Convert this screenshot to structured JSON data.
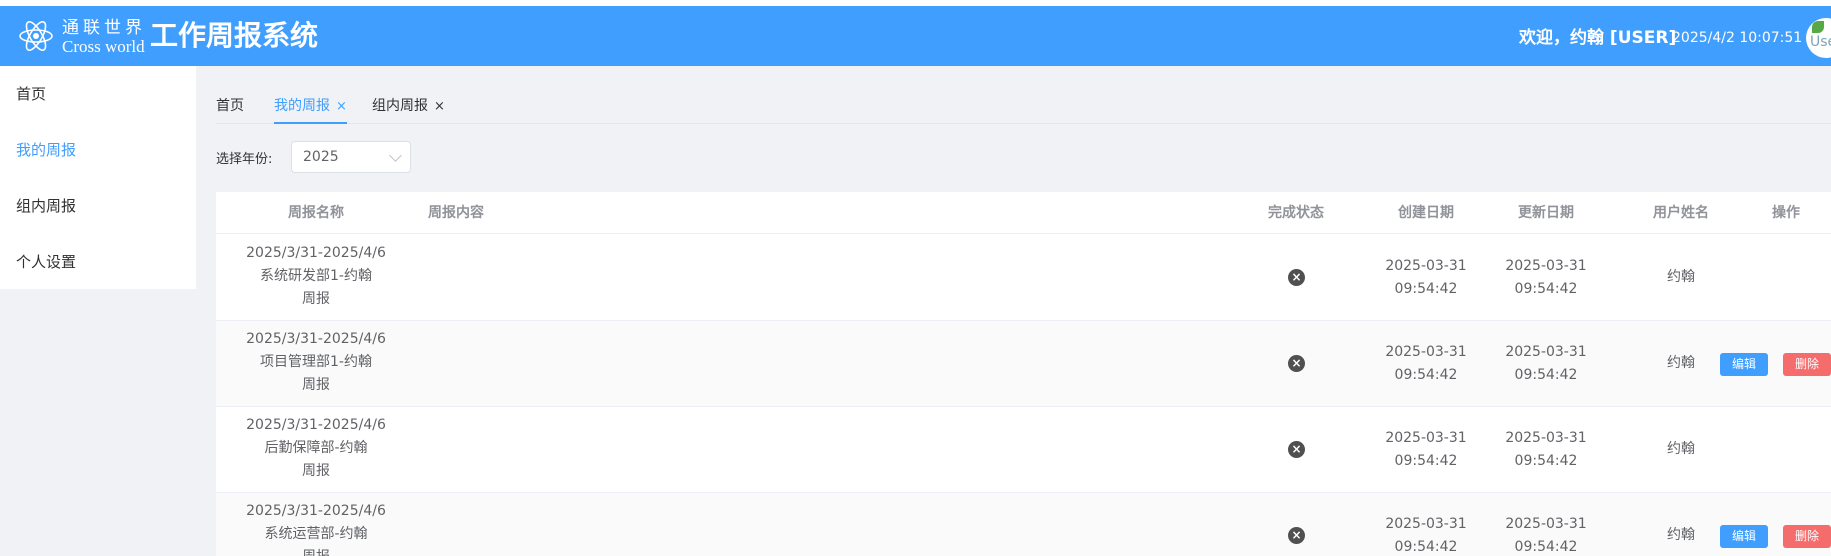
{
  "header": {
    "brand_cn": "通联世界",
    "brand_en": "Cross world",
    "app_title": "工作周报系统",
    "welcome": "欢迎，约翰 [USER]",
    "datetime": "2025/4/2 10:07:51",
    "avatar_text": "Use"
  },
  "sidebar": {
    "items": [
      {
        "label": "首页"
      },
      {
        "label": "我的周报"
      },
      {
        "label": "组内周报"
      },
      {
        "label": "个人设置"
      }
    ]
  },
  "tabs": [
    {
      "label": "首页"
    },
    {
      "label": "我的周报"
    },
    {
      "label": "组内周报"
    }
  ],
  "tab_close_glyph": "×",
  "filter": {
    "label": "选择年份:",
    "year": "2025"
  },
  "table": {
    "columns": [
      "周报名称",
      "周报内容",
      "完成状态",
      "创建日期",
      "更新日期",
      "用户姓名",
      "操作"
    ],
    "rows": [
      {
        "name_1": "2025/3/31-2025/4/6",
        "name_2": "系统研发部1-约翰",
        "name_3": "周报",
        "created_date": "2025-03-31",
        "created_time": "09:54:42",
        "updated_date": "2025-03-31",
        "updated_time": "09:54:42",
        "user": "约翰"
      },
      {
        "name_1": "2025/3/31-2025/4/6",
        "name_2": "项目管理部1-约翰",
        "name_3": "周报",
        "created_date": "2025-03-31",
        "created_time": "09:54:42",
        "updated_date": "2025-03-31",
        "updated_time": "09:54:42",
        "user": "约翰"
      },
      {
        "name_1": "2025/3/31-2025/4/6",
        "name_2": "后勤保障部-约翰",
        "name_3": "周报",
        "created_date": "2025-03-31",
        "created_time": "09:54:42",
        "updated_date": "2025-03-31",
        "updated_time": "09:54:42",
        "user": "约翰"
      },
      {
        "name_1": "2025/3/31-2025/4/6",
        "name_2": "系统运营部-约翰",
        "name_3": "周报",
        "created_date": "2025-03-31",
        "created_time": "09:54:42",
        "updated_date": "2025-03-31",
        "updated_time": "09:54:42",
        "user": "约翰"
      }
    ],
    "status_glyph": "×",
    "edit_label": "编辑",
    "delete_label": "删除"
  },
  "colors": {
    "primary": "#409eff",
    "danger": "#f56c6c",
    "page_bg": "#f0f2f5"
  }
}
